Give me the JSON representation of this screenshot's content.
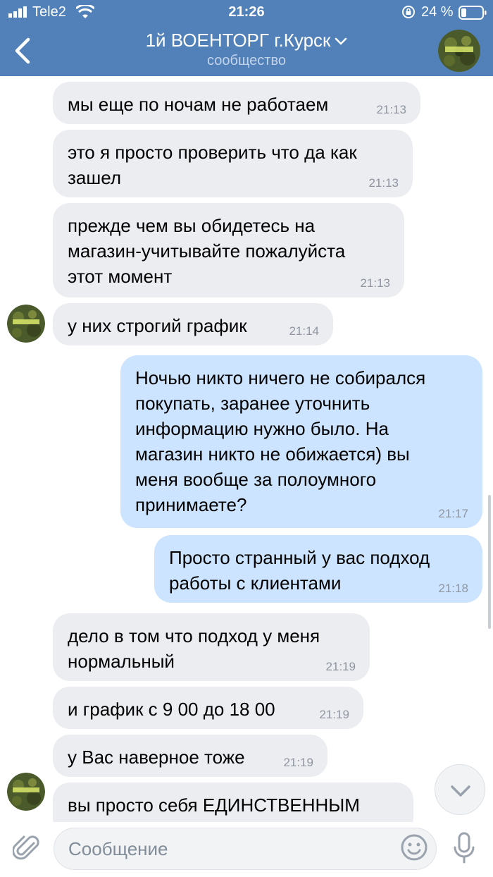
{
  "status": {
    "carrier": "Tele2",
    "time": "21:26",
    "battery_pct": "24 %"
  },
  "header": {
    "title": "1й ВОЕНТОРГ г.Курск",
    "subtitle": "сообщество",
    "color": "#5181b8"
  },
  "messages": [
    {
      "dir": "in",
      "text": "мы еще по ночам не работаем",
      "time": "21:13"
    },
    {
      "dir": "in",
      "text": "это я просто проверить что да как\nзашел",
      "time": "21:13"
    },
    {
      "dir": "in",
      "text": "прежде чем вы обидетесь на\nмагазин-учитывайте пожалуйста\nэтот момент",
      "time": "21:13"
    },
    {
      "dir": "in",
      "text": "у них строгий график",
      "time": "21:14"
    },
    {
      "dir": "out",
      "text": "Ночью никто ничего не собирался\nпокупать, заранее уточнить\nинформацию нужно было. На\nмагазин никто не обижается) вы\nменя вообще за полоумного\nпринимаете?",
      "time": "21:17"
    },
    {
      "dir": "out",
      "text": "Просто странный у вас подход\nработы с клиентами",
      "time": "21:18"
    },
    {
      "dir": "in",
      "text": "дело в том что подход у меня\nнормальный",
      "time": "21:19"
    },
    {
      "dir": "in",
      "text": "и график с 9 00 до 18 00",
      "time": "21:19"
    },
    {
      "dir": "in",
      "text": "у Вас наверное тоже",
      "time": "21:19"
    },
    {
      "dir": "in",
      "text": "вы просто себя ЕДИНСТВЕННЫМ",
      "time": ""
    }
  ],
  "avatar_label": "1-й ВОЕНТОРГ",
  "composer": {
    "placeholder": "Сообщение"
  },
  "colors": {
    "incoming_bubble": "#ecedf1",
    "outgoing_bubble": "#cce4ff"
  },
  "icons": [
    "back-arrow-icon",
    "chevron-down-icon",
    "paperclip-icon",
    "smile-icon",
    "microphone-icon",
    "scroll-down-icon"
  ]
}
